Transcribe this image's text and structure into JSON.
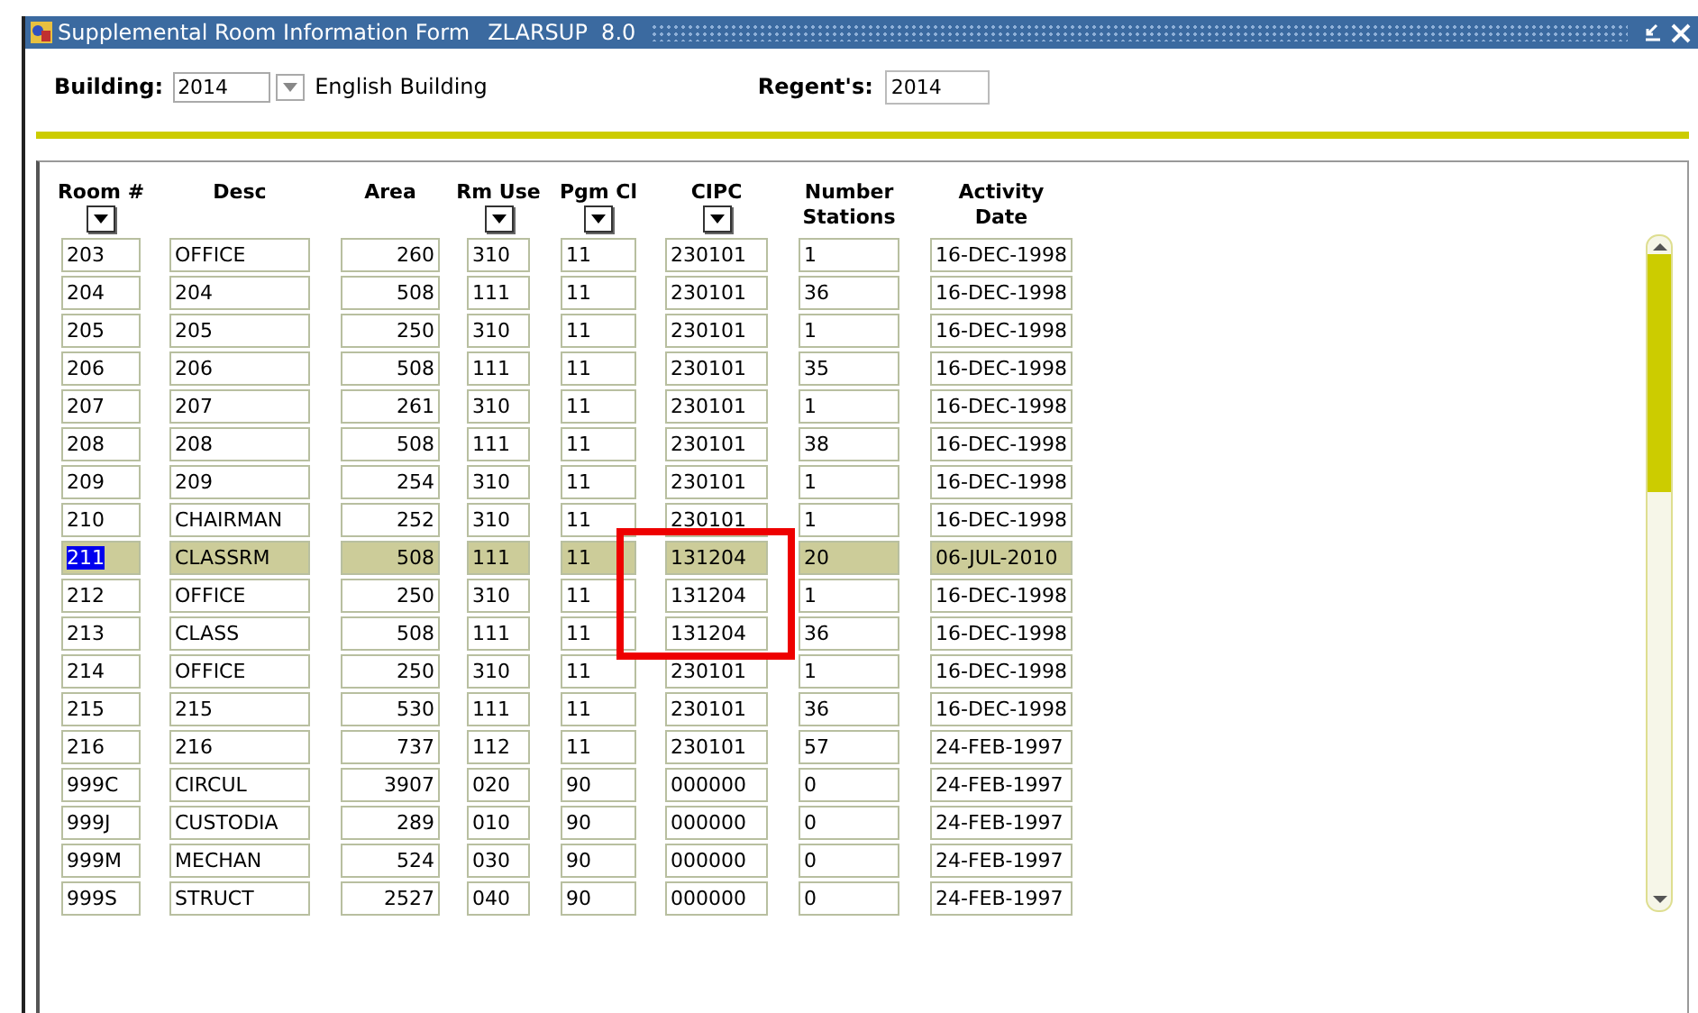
{
  "window": {
    "title": "Supplemental Room Information Form",
    "form_code": "ZLARSUP  8.0"
  },
  "header": {
    "building_label": "Building:",
    "building_value": "2014",
    "building_name": "English Building",
    "regent_label": "Regent's:",
    "regent_value": "2014"
  },
  "table": {
    "columns": [
      {
        "label": "Room #",
        "dropdown": true
      },
      {
        "label": "Desc",
        "dropdown": false
      },
      {
        "label": "Area",
        "dropdown": false
      },
      {
        "label": "Rm Use",
        "dropdown": true
      },
      {
        "label": "Pgm Cl",
        "dropdown": true
      },
      {
        "label": "CIPC",
        "dropdown": true
      },
      {
        "label": "Number Stations",
        "dropdown": false
      },
      {
        "label": "Activity Date",
        "dropdown": false
      }
    ],
    "rows": [
      {
        "selected": false,
        "cells": [
          "203",
          "OFFICE",
          "260",
          "310",
          "11",
          "230101",
          "1",
          "16-DEC-1998"
        ]
      },
      {
        "selected": false,
        "cells": [
          "204",
          "204",
          "508",
          "111",
          "11",
          "230101",
          "36",
          "16-DEC-1998"
        ]
      },
      {
        "selected": false,
        "cells": [
          "205",
          "205",
          "250",
          "310",
          "11",
          "230101",
          "1",
          "16-DEC-1998"
        ]
      },
      {
        "selected": false,
        "cells": [
          "206",
          "206",
          "508",
          "111",
          "11",
          "230101",
          "35",
          "16-DEC-1998"
        ]
      },
      {
        "selected": false,
        "cells": [
          "207",
          "207",
          "261",
          "310",
          "11",
          "230101",
          "1",
          "16-DEC-1998"
        ]
      },
      {
        "selected": false,
        "cells": [
          "208",
          "208",
          "508",
          "111",
          "11",
          "230101",
          "38",
          "16-DEC-1998"
        ]
      },
      {
        "selected": false,
        "cells": [
          "209",
          "209",
          "254",
          "310",
          "11",
          "230101",
          "1",
          "16-DEC-1998"
        ]
      },
      {
        "selected": false,
        "cells": [
          "210",
          "CHAIRMAN",
          "252",
          "310",
          "11",
          "230101",
          "1",
          "16-DEC-1998"
        ]
      },
      {
        "selected": true,
        "cells": [
          "211",
          "CLASSRM",
          "508",
          "111",
          "11",
          "131204",
          "20",
          "06-JUL-2010"
        ]
      },
      {
        "selected": false,
        "cells": [
          "212",
          "OFFICE",
          "250",
          "310",
          "11",
          "131204",
          "1",
          "16-DEC-1998"
        ]
      },
      {
        "selected": false,
        "cells": [
          "213",
          "CLASS",
          "508",
          "111",
          "11",
          "131204",
          "36",
          "16-DEC-1998"
        ]
      },
      {
        "selected": false,
        "cells": [
          "214",
          "OFFICE",
          "250",
          "310",
          "11",
          "230101",
          "1",
          "16-DEC-1998"
        ]
      },
      {
        "selected": false,
        "cells": [
          "215",
          "215",
          "530",
          "111",
          "11",
          "230101",
          "36",
          "16-DEC-1998"
        ]
      },
      {
        "selected": false,
        "cells": [
          "216",
          "216",
          "737",
          "112",
          "11",
          "230101",
          "57",
          "24-FEB-1997"
        ]
      },
      {
        "selected": false,
        "cells": [
          "999C",
          "CIRCUL",
          "3907",
          "020",
          "90",
          "000000",
          "0",
          "24-FEB-1997"
        ]
      },
      {
        "selected": false,
        "cells": [
          "999J",
          "CUSTODIA",
          "289",
          "010",
          "90",
          "000000",
          "0",
          "24-FEB-1997"
        ]
      },
      {
        "selected": false,
        "cells": [
          "999M",
          "MECHAN",
          "524",
          "030",
          "90",
          "000000",
          "0",
          "24-FEB-1997"
        ]
      },
      {
        "selected": false,
        "cells": [
          "999S",
          "STRUCT",
          "2527",
          "040",
          "90",
          "000000",
          "0",
          "24-FEB-1997"
        ]
      }
    ]
  }
}
